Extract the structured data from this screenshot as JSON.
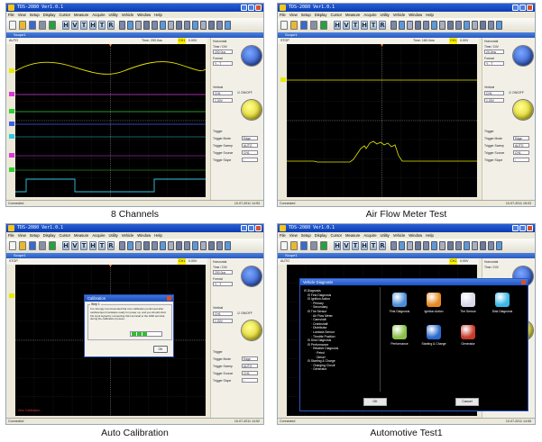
{
  "app": {
    "title": "TDS-2080 Ver1.0.1",
    "menu": [
      "File",
      "View",
      "Setup",
      "Display",
      "Cursor",
      "Measure",
      "Acquire",
      "Utility",
      "Vehicle",
      "Window",
      "Help"
    ],
    "toolbar_letters": [
      "H",
      "V",
      "T",
      "H",
      "T",
      "R"
    ],
    "scope_window": "Scope1",
    "status_left": "Connected",
    "status_time_a": "10-07-2011  14:53",
    "status_time_b": "10-07-2011  15:03",
    "status_time_c": "10-07-2011  14:52",
    "status_time_d": "10-07-2011  14:55"
  },
  "right_panel": {
    "horizontal": "Horizontal",
    "time_div": "Time / DIV",
    "time_val_1": "200.0us",
    "time_val_2": "20.0ms",
    "format": "Format",
    "format_val": "Y - T",
    "vertical": "Vertical",
    "ch_val": "CH1",
    "volt_val": "1.00V",
    "onoff": "ON/OFF",
    "trigger": "Trigger",
    "trigger_mode": "Trigger Mode",
    "trigger_mode_val": "Edge",
    "trigger_sweep": "Trigger Sweep",
    "trigger_sweep_val": "AUTO",
    "trigger_source": "Trigger Source",
    "trigger_source_val": "CH1",
    "trigger_slope": "Trigger Slope",
    "trigger_slope_val": "↑"
  },
  "status_rows": {
    "run_1": "AUTO",
    "run_2": "STOP",
    "time_1": "Time: 200.0us",
    "time_2": "Time: 180.0ms",
    "ch1_lvl_1": "CH1",
    "ch1_lvl_val": "0.00V"
  },
  "calibration": {
    "title": "Calibration",
    "step": "Step 1",
    "message": "It is strongly recommended that zero calibration performed after oscilloscope's hardware ready for power up, and you should short CH input signal by connecting CH1 terminal to the GND terminal during the calibration process.",
    "ok": "OK",
    "footnote": "Zero Calibration..."
  },
  "vehicle": {
    "title": "Vehicle Diagnosis",
    "tree": [
      "Diagnosis",
      "First Diagnosis",
      "Ignition Action",
      "Primary",
      "Secondary",
      "The Sensor",
      "Air Flow Meter",
      "Camshaft",
      "Crankshaft",
      "Distributor",
      "Lambda Sensor",
      "Throttle Position",
      "Disk Diagnosis",
      "Performance",
      "Relative Diagnosis",
      "Petrol",
      "Diesel",
      "Starting & Charge",
      "Charging Circuit",
      "Generator"
    ],
    "icons": [
      {
        "label": "First Diagnosis",
        "icon": "monitor-icon",
        "color": "#4a8ed8"
      },
      {
        "label": "Ignition Action",
        "icon": "person-icon",
        "color": "#e88a20"
      },
      {
        "label": "The Sensor",
        "icon": "document-icon",
        "color": "#d8d8e8"
      },
      {
        "label": "Disk Diagnosis",
        "icon": "disk-icon",
        "color": "#3ab8e8"
      },
      {
        "label": "Performance",
        "icon": "calculator-icon",
        "color": "#8ac048"
      },
      {
        "label": "Starting & Charge",
        "icon": "swirl-icon",
        "color": "#2c6ad0"
      },
      {
        "label": "Generator",
        "icon": "car-icon",
        "color": "#c83a2a"
      }
    ],
    "ok": "OK",
    "cancel": "Cancel"
  },
  "captions": {
    "c1": "8 Channels",
    "c2": "Air Flow Meter Test",
    "c3": "Auto Calibration",
    "c4": "Automotive Test1"
  },
  "colors": {
    "ch_yellow": "#e8e800",
    "ch_magenta": "#d83ad8",
    "ch_green": "#30d030",
    "ch_cyan": "#30c8e0",
    "ch_blue": "#3a60e8"
  }
}
